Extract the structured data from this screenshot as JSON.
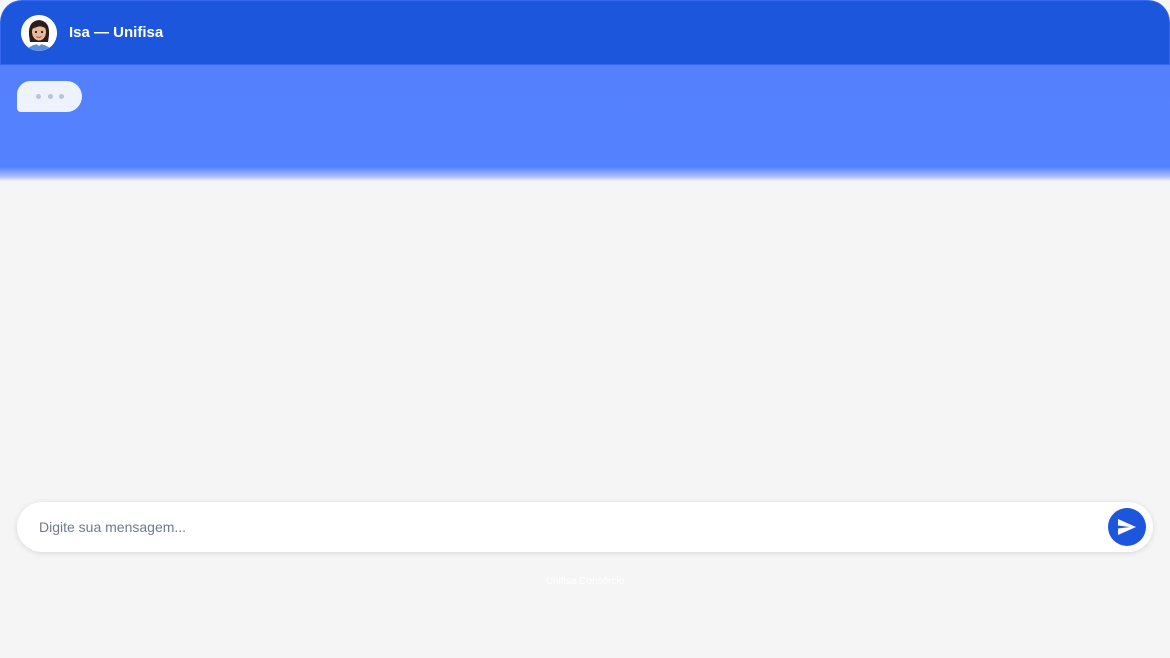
{
  "header": {
    "title": "Isa — Unifisa",
    "avatar_icon": "assistant-avatar-icon",
    "color": "#1c56dc"
  },
  "messages": {
    "typing_indicator_icon": "typing-dots-icon",
    "background": "#5482ff"
  },
  "composer": {
    "placeholder": "Digite sua mensagem...",
    "value": "",
    "send_icon": "send-icon"
  },
  "footer": {
    "note": "Unifisa Consórcio"
  }
}
